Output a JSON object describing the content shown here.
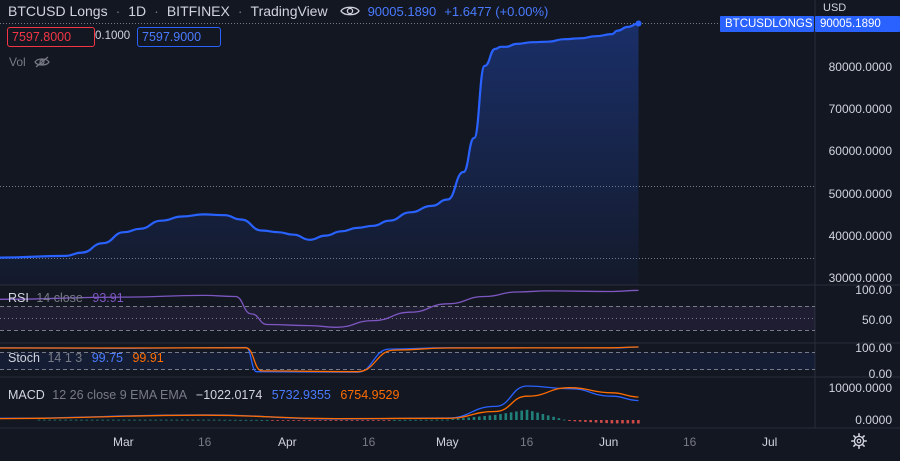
{
  "header": {
    "symbol": "BTCUSD Longs",
    "interval": "1D",
    "exchange": "BITFINEX",
    "source": "TradingView",
    "last_value": "90005.1890",
    "change": "+1.6477 (+0.00%)",
    "currency_button": "USD",
    "eye_icon": "eye-icon"
  },
  "order_panel": {
    "sell_price": "7597.8000",
    "size": "0.1000",
    "buy_price": "7597.9000"
  },
  "volume_label": "Vol",
  "price_tag": {
    "label": "BTCUSDLONGS",
    "value": "90005.1890"
  },
  "price_axis": [
    "80000.0000",
    "70000.0000",
    "60000.0000",
    "50000.0000",
    "40000.0000",
    "30000.0000"
  ],
  "rsi": {
    "name": "RSI",
    "params": "14 close",
    "value": "93.91",
    "axis": [
      "100.00",
      "50.00"
    ]
  },
  "stoch": {
    "name": "Stoch",
    "params": "14 1 3",
    "k": "99.75",
    "d": "99.91",
    "axis": [
      "100.00",
      "0.00"
    ]
  },
  "macd": {
    "name": "MACD",
    "params": "12 26 close 9 EMA EMA",
    "hist": "−1022.0174",
    "macd": "5732.9355",
    "signal": "6754.9529",
    "axis": [
      "10000.0000",
      "0.0000"
    ]
  },
  "time_axis": [
    "Mar",
    "16",
    "Apr",
    "16",
    "May",
    "16",
    "Jun",
    "16",
    "Jul"
  ],
  "colors": {
    "background": "#131722",
    "price_line": "#2962ff",
    "rsi": "#7e57c2",
    "stoch_k": "#2962ff",
    "stoch_d": "#ff6d00",
    "macd": "#2962ff",
    "signal": "#ff6d00",
    "hist_up": "#26a69a",
    "hist_down": "#ef5350"
  },
  "chart_data": [
    {
      "type": "area",
      "title": "BTCUSD Longs",
      "ylim": [
        30000,
        90000
      ],
      "x_ticks": [
        "Mar",
        "16",
        "Apr",
        "16",
        "May",
        "16",
        "Jun",
        "16",
        "Jul"
      ],
      "series": [
        {
          "name": "BTCUSD Longs",
          "x": [
            "Feb 14",
            "Feb 19",
            "Feb 22",
            "Feb 26",
            "Mar 1",
            "Mar 4",
            "Mar 8",
            "Mar 12",
            "Mar 16",
            "Mar 20",
            "Mar 23",
            "Mar 27",
            "Mar 30",
            "Apr 2",
            "Apr 5",
            "Apr 8",
            "Apr 11",
            "Apr 14",
            "Apr 17",
            "Apr 20",
            "Apr 24",
            "Apr 28",
            "May 1",
            "May 4",
            "May 6",
            "May 8",
            "May 10",
            "May 11",
            "May 12",
            "May 14",
            "May 17",
            "May 20",
            "May 23",
            "May 26",
            "May 29",
            "Jun 1",
            "Jun 2",
            "Jun 4",
            "Jun 6"
          ],
          "values": [
            34800,
            35200,
            36000,
            38200,
            40800,
            41600,
            43500,
            44500,
            45000,
            44800,
            43800,
            41200,
            40800,
            40200,
            39000,
            40000,
            41000,
            41800,
            42300,
            43500,
            45500,
            47000,
            48500,
            55000,
            63000,
            80000,
            84000,
            84500,
            84500,
            85200,
            85600,
            85700,
            86300,
            86500,
            87000,
            87500,
            88300,
            89200,
            90005
          ]
        }
      ]
    },
    {
      "type": "line",
      "title": "RSI 14 close",
      "ylim": [
        0,
        100
      ],
      "series": [
        {
          "name": "RSI",
          "x": [
            "Feb 14",
            "Mar 1",
            "Mar 16",
            "Mar 22",
            "Mar 25",
            "Mar 28",
            "Apr 5",
            "Apr 10",
            "Apr 17",
            "Apr 24",
            "May 1",
            "May 8",
            "May 14",
            "May 20",
            "Jun 1",
            "Jun 6"
          ],
          "values": [
            78,
            82,
            85,
            83,
            52,
            33,
            31,
            28,
            40,
            55,
            70,
            83,
            91,
            93,
            92,
            93.91
          ]
        }
      ]
    },
    {
      "type": "line",
      "title": "Stoch 14 1 3",
      "ylim": [
        0,
        100
      ],
      "series": [
        {
          "name": "%K",
          "x": [
            "Feb 14",
            "Mar 1",
            "Mar 24",
            "Mar 26",
            "Apr 14",
            "Apr 20",
            "May 1",
            "Jun 1",
            "Jun 6"
          ],
          "values": [
            97,
            95,
            98,
            5,
            3,
            92,
            97,
            96,
            99.75
          ]
        },
        {
          "name": "%D",
          "x": [
            "Feb 14",
            "Mar 1",
            "Mar 24",
            "Mar 27",
            "Apr 14",
            "Apr 21",
            "May 1",
            "Jun 1",
            "Jun 6"
          ],
          "values": [
            96,
            96,
            97,
            8,
            5,
            88,
            96,
            97,
            99.91
          ]
        }
      ]
    },
    {
      "type": "line",
      "title": "MACD 12 26 close 9 EMA EMA",
      "ylim": [
        -1000,
        12000
      ],
      "series": [
        {
          "name": "MACD",
          "x": [
            "Feb 14",
            "Mar 16",
            "Apr 10",
            "May 1",
            "May 10",
            "May 16",
            "May 24",
            "Jun 1",
            "Jun 6"
          ],
          "values": [
            500,
            1500,
            300,
            600,
            4000,
            10000,
            9200,
            7000,
            5732.9355
          ]
        },
        {
          "name": "Signal",
          "x": [
            "Feb 14",
            "Mar 16",
            "Apr 10",
            "May 1",
            "May 10",
            "May 16",
            "May 24",
            "Jun 1",
            "Jun 6"
          ],
          "values": [
            400,
            1400,
            400,
            500,
            2500,
            7000,
            9500,
            8000,
            6754.9529
          ]
        }
      ]
    }
  ]
}
